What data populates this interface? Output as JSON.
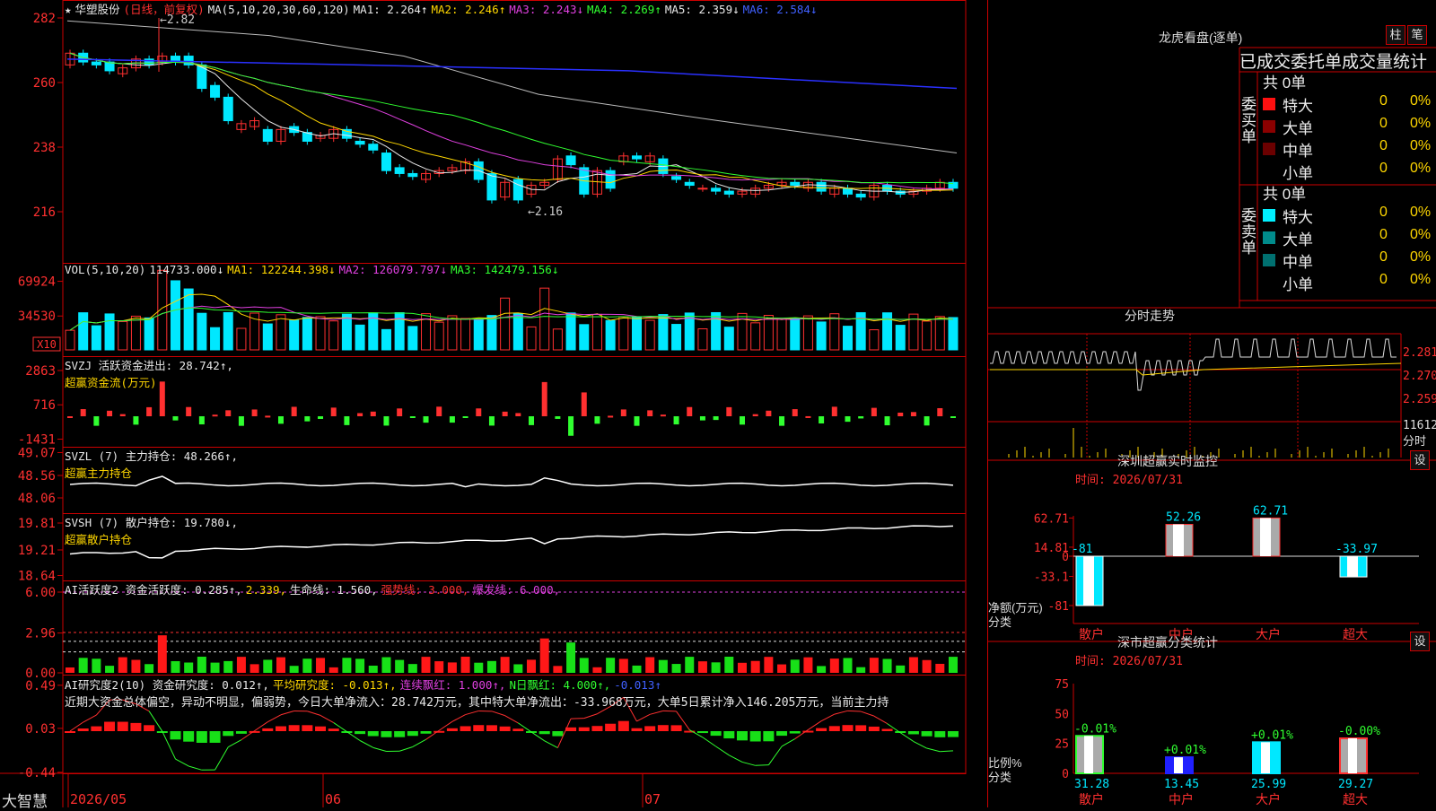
{
  "app": {
    "brand": "大智慧"
  },
  "stock": {
    "name": "华塑股份",
    "period": "(日线，前复权)"
  },
  "main_panel": {
    "ma_label": "MA(5,10,20,30,60,120)",
    "mas": [
      {
        "k": "MA1:",
        "v": "2.264↑",
        "color": "#e8e8e8"
      },
      {
        "k": "MA2:",
        "v": "2.246↑",
        "color": "#ffd700"
      },
      {
        "k": "MA3:",
        "v": "2.243↓",
        "color": "#e040e0"
      },
      {
        "k": "MA4:",
        "v": "2.269↑",
        "color": "#30ff30"
      },
      {
        "k": "MA5:",
        "v": "2.359↓",
        "color": "#e8e8e8"
      },
      {
        "k": "MA6:",
        "v": "2.584↓",
        "color": "#4060ff"
      }
    ],
    "high_note": "2.82",
    "low_note": "←2.16"
  },
  "vol_panel": {
    "label": "VOL(5,10,20)",
    "value": "114733.000↓",
    "ma1": "MA1: 122244.398↓",
    "ma2": "MA2: 126079.797↓",
    "ma3": "MA3: 142479.156↓",
    "unit": "X10"
  },
  "svzj_panel": {
    "l1": "SVZJ  活跃资金进出: 28.742↑,",
    "l2": "超赢资金流(万元)"
  },
  "svzl_panel": {
    "l1": "SVZL (7) 主力持仓: 48.266↑,",
    "l2": "超赢主力持仓"
  },
  "svsh_panel": {
    "l1": "SVSH (7) 散户持仓: 19.780↓,",
    "l2": "超赢散户持仓"
  },
  "ai1_panel": {
    "l1": "AI活跃度2 资金活跃度: 0.285↑,",
    "l1b": "2.339,",
    "l1c": "生命线: 1.560,",
    "l1d": "强势线: 3.000,",
    "l1e": "爆发线: 6.000,"
  },
  "ai2_panel": {
    "l1": "AI研究度2(10) 资金研究度: 0.012↑,",
    "l1b": "平均研究度: -0.013↑,",
    "l1c": "连续飘红: 1.000↑,",
    "l1d": "N日飘红: 4.000↑,",
    "l1e": "-0.013↑",
    "comment": "近期大资金总体偏空，异动不明显，偏弱势，今日大单净流入：28.742万元，其中特大单净流出：-33.968万元，大单5日累计净入146.205万元，当前主力持"
  },
  "x_axis": [
    "2026/05",
    "06",
    "07"
  ],
  "chart_data": [
    {
      "type": "candlestick",
      "name": "price",
      "y_ticks": [
        282,
        260,
        238,
        216
      ],
      "ylim": [
        2.12,
        2.84
      ],
      "closes": [
        2.7,
        2.67,
        2.66,
        2.64,
        2.65,
        2.68,
        2.66,
        2.69,
        2.67,
        2.66,
        2.58,
        2.55,
        2.47,
        2.46,
        2.47,
        2.4,
        2.44,
        2.43,
        2.4,
        2.42,
        2.44,
        2.41,
        2.39,
        2.37,
        2.3,
        2.29,
        2.28,
        2.29,
        2.3,
        2.31,
        2.33,
        2.27,
        2.2,
        2.26,
        2.2,
        2.25,
        2.26,
        2.34,
        2.32,
        2.22,
        2.3,
        2.24,
        2.35,
        2.34,
        2.35,
        2.29,
        2.27,
        2.25,
        2.24,
        2.23,
        2.22,
        2.23,
        2.24,
        2.25,
        2.26,
        2.25,
        2.26,
        2.23,
        2.24,
        2.22,
        2.21,
        2.25,
        2.23,
        2.22,
        2.23,
        2.24,
        2.26,
        2.24
      ],
      "opens": [
        2.66,
        2.7,
        2.67,
        2.67,
        2.63,
        2.65,
        2.68,
        2.67,
        2.69,
        2.69,
        2.66,
        2.59,
        2.55,
        2.44,
        2.45,
        2.44,
        2.4,
        2.45,
        2.43,
        2.41,
        2.41,
        2.44,
        2.4,
        2.39,
        2.36,
        2.31,
        2.29,
        2.27,
        2.29,
        2.3,
        2.3,
        2.33,
        2.29,
        2.21,
        2.27,
        2.22,
        2.25,
        2.27,
        2.35,
        2.31,
        2.22,
        2.3,
        2.33,
        2.35,
        2.33,
        2.34,
        2.28,
        2.26,
        2.24,
        2.24,
        2.23,
        2.22,
        2.22,
        2.24,
        2.25,
        2.26,
        2.24,
        2.26,
        2.22,
        2.24,
        2.22,
        2.21,
        2.25,
        2.23,
        2.22,
        2.23,
        2.24,
        2.26
      ]
    },
    {
      "type": "bar",
      "name": "volume",
      "y_ticks": [
        69924,
        34530
      ]
    },
    {
      "type": "bar",
      "name": "SVZJ",
      "y_ticks": [
        2863,
        716,
        -1431
      ]
    },
    {
      "type": "line",
      "name": "SVZL",
      "y_ticks": [
        49.07,
        48.56,
        48.06
      ]
    },
    {
      "type": "line",
      "name": "SVSH",
      "y_ticks": [
        19.81,
        19.21,
        18.64
      ]
    },
    {
      "type": "bar",
      "name": "AI活跃度2",
      "y_ticks": [
        6.0,
        2.96,
        0.0
      ]
    },
    {
      "type": "bar",
      "name": "AI研究度2",
      "y_ticks": [
        0.49,
        0.03,
        -0.44
      ]
    },
    {
      "type": "bar",
      "name": "深圳超赢实时监控",
      "categories": [
        "散户",
        "中户",
        "大户",
        "超大"
      ],
      "values": [
        -81,
        52.26,
        62.71,
        -33.97
      ],
      "y_ticks": [
        62.71,
        14.81,
        0,
        -33.1,
        -81
      ]
    },
    {
      "type": "bar",
      "name": "深市超赢分类统计",
      "categories": [
        "散户",
        "中户",
        "大户",
        "超大"
      ],
      "values": [
        31.28,
        13.45,
        25.99,
        29.27
      ],
      "changes": [
        "-0.01%",
        "+0.01%",
        "+0.01%",
        "-0.00%"
      ],
      "y_ticks": [
        75,
        50,
        25,
        0
      ]
    }
  ],
  "right": {
    "lhb_title": "龙虎看盘(逐单)",
    "btn_zhu": "柱",
    "btn_bi": "笔",
    "tabs": [
      "已成交",
      "委托单",
      "成交量统计"
    ],
    "buy_label": "委买单",
    "sell_label": "委卖单",
    "buy_total": "共 0单",
    "sell_total": "共 0单",
    "rows": [
      {
        "label": "特大",
        "val": "0",
        "pct": "0%"
      },
      {
        "label": "大单",
        "val": "0",
        "pct": "0%"
      },
      {
        "label": "中单",
        "val": "0",
        "pct": "0%"
      },
      {
        "label": "小单",
        "val": "0",
        "pct": "0%"
      }
    ],
    "fs_title": "分时走势",
    "fs_prices": [
      "2.281",
      "2.270",
      "2.259"
    ],
    "fs_vol": "11612",
    "fs_vol_label": "分时",
    "mon_title": "深圳超赢实时监控",
    "mon_set": "设",
    "mon_time": "时间: 2026/07/31",
    "mon_ylabel": "净额(万元)",
    "mon_xlabel": "分类",
    "stat_title": "深市超赢分类统计",
    "stat_set": "设",
    "stat_time": "时间: 2026/07/31",
    "stat_ylabel": "比例%",
    "stat_xlabel": "分类"
  }
}
